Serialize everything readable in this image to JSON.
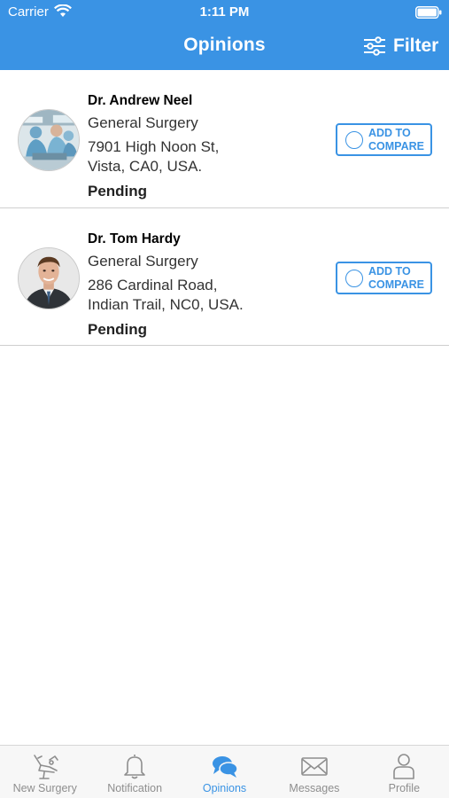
{
  "status_bar": {
    "carrier": "Carrier",
    "time": "1:11 PM"
  },
  "header": {
    "title": "Opinions",
    "filter_label": "Filter",
    "color": "#3a93e4"
  },
  "doctors": [
    {
      "name": "Dr. Andrew Neel",
      "specialty": "General Surgery",
      "address": "7901 High Noon St,\nVista, CA0, USA.",
      "status": "Pending",
      "compare_label": "ADD TO\nCOMPARE",
      "photo": "surgical-team-photo"
    },
    {
      "name": "Dr. Tom Hardy",
      "specialty": "General Surgery",
      "address": "286 Cardinal Road,\nIndian Trail, NC0, USA.",
      "status": "Pending",
      "compare_label": "ADD TO\nCOMPARE",
      "photo": "doctor-portrait-photo"
    }
  ],
  "tabs": [
    {
      "label": "New Surgery",
      "icon": "dental-chair-icon",
      "active": false
    },
    {
      "label": "Notification",
      "icon": "bell-icon",
      "active": false
    },
    {
      "label": "Opinions",
      "icon": "chat-bubbles-icon",
      "active": true
    },
    {
      "label": "Messages",
      "icon": "envelope-icon",
      "active": false
    },
    {
      "label": "Profile",
      "icon": "person-icon",
      "active": false
    }
  ]
}
